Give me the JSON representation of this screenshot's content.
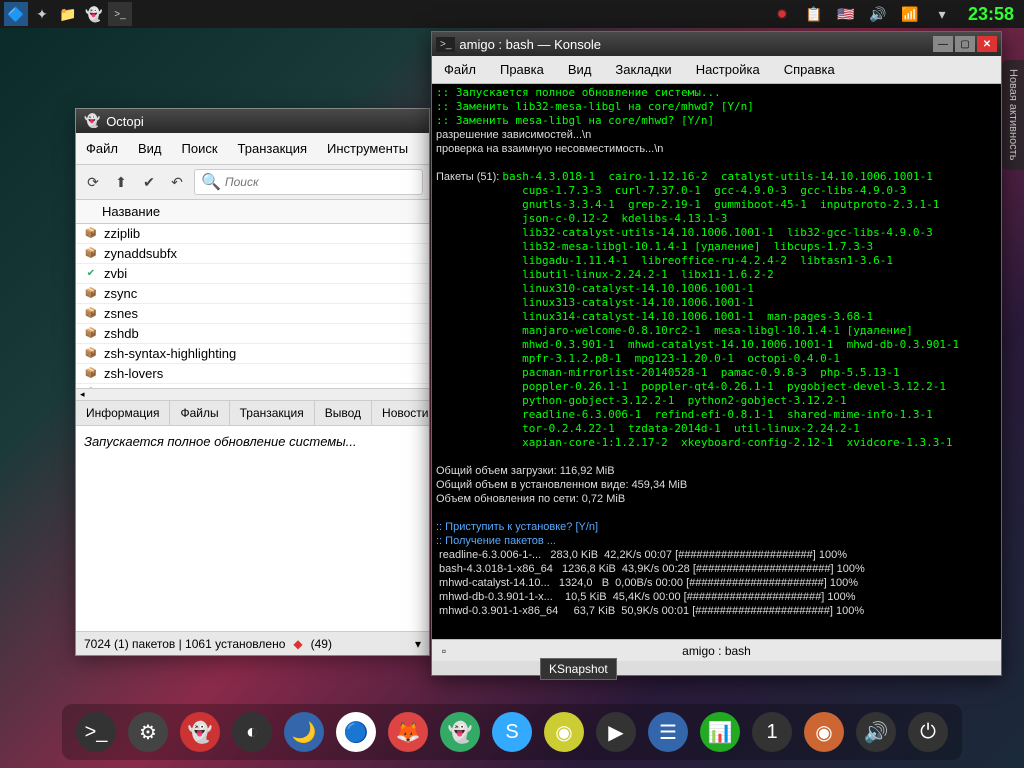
{
  "taskbar": {
    "clock": "23:58"
  },
  "sidebar": {
    "label": "Новая активность"
  },
  "octopi": {
    "title": "Octopi",
    "menu": [
      "Файл",
      "Вид",
      "Поиск",
      "Транзакция",
      "Инструменты"
    ],
    "search_placeholder": "Поиск",
    "header": "Название",
    "packages": [
      {
        "name": "zziplib",
        "icon": "box"
      },
      {
        "name": "zynaddsubfx",
        "icon": "box"
      },
      {
        "name": "zvbi",
        "icon": "check"
      },
      {
        "name": "zsync",
        "icon": "box"
      },
      {
        "name": "zsnes",
        "icon": "box"
      },
      {
        "name": "zshdb",
        "icon": "box"
      },
      {
        "name": "zsh-syntax-highlighting",
        "icon": "box"
      },
      {
        "name": "zsh-lovers",
        "icon": "box"
      },
      {
        "name": "zsh-doc",
        "icon": "box"
      }
    ],
    "tabs": [
      "Информация",
      "Файлы",
      "Транзакция",
      "Вывод",
      "Новости"
    ],
    "info_text": "Запускается полное обновление системы...",
    "status": {
      "left": "7024 (1) пакетов | 1061 установлено",
      "updates": "(49)"
    }
  },
  "konsole": {
    "title": "amigo : bash — Konsole",
    "menu": [
      "Файл",
      "Правка",
      "Вид",
      "Закладки",
      "Настройка",
      "Справка"
    ],
    "tab_label": "amigo : bash",
    "terminal": ":: Запускается полное обновление системы...\n:: Заменить lib32-mesa-libgl на core/mhwd? [Y/n]\n:: Заменить mesa-libgl на core/mhwd? [Y/n]\n<w>разрешение зависимостей...\\n</w>\n<w>проверка на взаимную несовместимость...\\n</w>\n\n<w>Пакеты (51): </w>bash-4.3.018-1  cairo-1.12.16-2  catalyst-utils-14.10.1006.1001-1\n             cups-1.7.3-3  curl-7.37.0-1  gcc-4.9.0-3  gcc-libs-4.9.0-3\n             gnutls-3.3.4-1  grep-2.19-1  gummiboot-45-1  inputproto-2.3.1-1\n             json-c-0.12-2  kdelibs-4.13.1-3\n             lib32-catalyst-utils-14.10.1006.1001-1  lib32-gcc-libs-4.9.0-3\n             lib32-mesa-libgl-10.1.4-1 [удаление]  libcups-1.7.3-3\n             libgadu-1.11.4-1  libreoffice-ru-4.2.4-2  libtasn1-3.6-1\n             libutil-linux-2.24.2-1  libx11-1.6.2-2\n             linux310-catalyst-14.10.1006.1001-1\n             linux313-catalyst-14.10.1006.1001-1\n             linux314-catalyst-14.10.1006.1001-1  man-pages-3.68-1\n             manjaro-welcome-0.8.10rc2-1  mesa-libgl-10.1.4-1 [удаление]\n             mhwd-0.3.901-1  mhwd-catalyst-14.10.1006.1001-1  mhwd-db-0.3.901-1\n             mpfr-3.1.2.p8-1  mpg123-1.20.0-1  octopi-0.4.0-1\n             pacman-mirrorlist-20140528-1  pamac-0.9.8-3  php-5.5.13-1\n             poppler-0.26.1-1  poppler-qt4-0.26.1-1  pygobject-devel-3.12.2-1\n             python-gobject-3.12.2-1  python2-gobject-3.12.2-1\n             readline-6.3.006-1  refind-efi-0.8.1-1  shared-mime-info-1.3-1\n             tor-0.2.4.22-1  tzdata-2014d-1  util-linux-2.24.2-1\n             xapian-core-1:1.2.17-2  xkeyboard-config-2.12-1  xvidcore-1.3.3-1\n\n<w>Общий объем загрузки: 116,92 MiB</w>\n<w>Общий объем в установленном виде: 459,34 MiB</w>\n<w>Объем обновления по сети: 0,72 MiB</w>\n\n<b>:: Приступить к установке? [Y/n]</b>\n<b>:: Получение пакетов ...</b>\n<w> readline-6.3.006-1-...   283,0 KiB  42,2K/s 00:07 [######################] 100%</w>\n<w> bash-4.3.018-1-x86_64   1236,8 KiB  43,9K/s 00:28 [######################] 100%</w>\n<w> mhwd-catalyst-14.10...   1324,0   B  0,00B/s 00:00 [######################] 100%</w>\n<w> mhwd-db-0.3.901-1-x...    10,5 KiB  45,4K/s 00:00 [######################] 100%</w>\n<w> mhwd-0.3.901-1-x86_64     63,7 KiB  50,9K/s 00:01 [######################] 100%</w>"
  },
  "tooltip": "KSnapshot",
  "dock_icons": [
    {
      "bg": "#333",
      "glyph": ">_"
    },
    {
      "bg": "#444",
      "glyph": "⚙"
    },
    {
      "bg": "#c33",
      "glyph": "👻"
    },
    {
      "bg": "#333",
      "glyph": "◐"
    },
    {
      "bg": "#36a",
      "glyph": "🌙"
    },
    {
      "bg": "#fff",
      "glyph": "🔵"
    },
    {
      "bg": "#d44",
      "glyph": "🦊"
    },
    {
      "bg": "#3a6",
      "glyph": "👻"
    },
    {
      "bg": "#3af",
      "glyph": "S"
    },
    {
      "bg": "#cc3",
      "glyph": "◉"
    },
    {
      "bg": "#333",
      "glyph": "▶"
    },
    {
      "bg": "#36a",
      "glyph": "☰"
    },
    {
      "bg": "#2a2",
      "glyph": "📊"
    },
    {
      "bg": "#333",
      "glyph": "1"
    },
    {
      "bg": "#c63",
      "glyph": "◉"
    },
    {
      "bg": "#333",
      "glyph": "🔊"
    },
    {
      "bg": "#333",
      "glyph": "⏻"
    }
  ]
}
